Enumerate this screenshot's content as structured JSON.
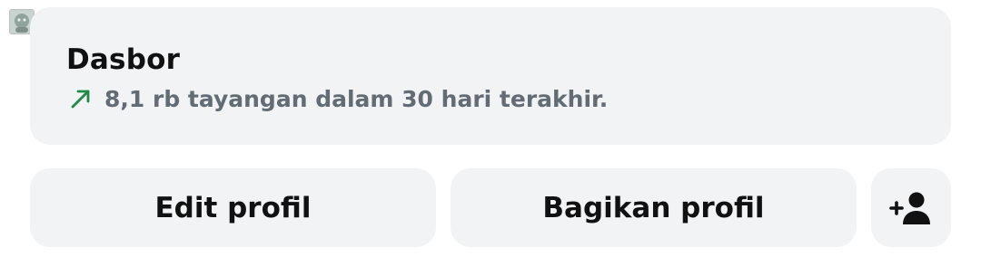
{
  "profile": {
    "avatar_icon": "profile-avatar"
  },
  "dashboard": {
    "title": "Dasbor",
    "trend_icon": "trending-up-arrow-icon",
    "trend_color": "#1f8a47",
    "stats_text": "8,1 rb tayangan dalam 30 hari terakhir."
  },
  "actions": {
    "edit_label": "Edit profil",
    "share_label": "Bagikan profil",
    "add_friend_icon": "add-person-icon"
  },
  "colors": {
    "card_background": "#f2f3f5",
    "primary_text": "#111111",
    "secondary_text": "#636b75"
  }
}
